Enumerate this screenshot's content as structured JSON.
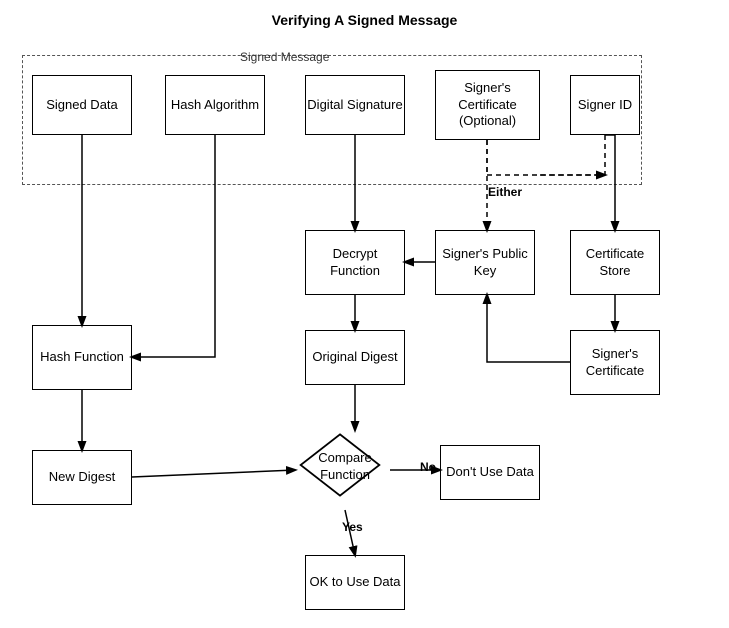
{
  "title": "Verifying A Signed Message",
  "signed_message_label": "Signed Message",
  "either_label": "Either",
  "yes_label": "Yes",
  "no_label": "No",
  "boxes": {
    "signed_data": "Signed Data",
    "hash_algorithm": "Hash Algorithm",
    "digital_signature": "Digital Signature",
    "signers_certificate_optional": "Signer's Certificate (Optional)",
    "signer_id": "Signer ID",
    "decrypt_function": "Decrypt Function",
    "signers_public_key": "Signer's Public Key",
    "certificate_store": "Certificate Store",
    "hash_function": "Hash Function",
    "original_digest": "Original Digest",
    "signers_certificate": "Signer's Certificate",
    "new_digest": "New Digest",
    "compare_function": "Compare Function",
    "dont_use_data": "Don't Use Data",
    "ok_to_use_data": "OK to Use Data"
  }
}
